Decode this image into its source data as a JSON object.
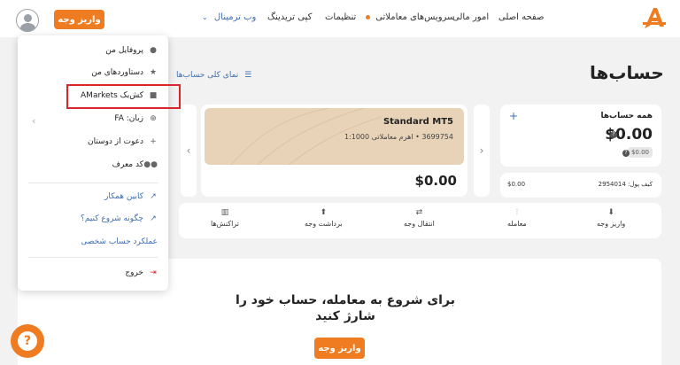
{
  "header": {
    "deposit_label": "واریز وجه",
    "nav": {
      "web_terminal": "وب ترمینال",
      "copy_trading": "کپی تریدینگ",
      "settings": "تنظیمات",
      "trading_services": "سرویس‌های معاملاتی",
      "finance": "امور مالی",
      "home": "صفحه اصلی"
    },
    "logo_letter": "A"
  },
  "dropdown": {
    "items": [
      {
        "label": "پروفایل من",
        "icon": "user-icon"
      },
      {
        "label": "دستاوردهای من",
        "icon": "star-icon"
      },
      {
        "label": "کش‌بک AMarkets",
        "icon": "gift-icon"
      },
      {
        "label": "زبان: FA",
        "icon": "globe-icon"
      },
      {
        "label": "دعوت از دوستان",
        "icon": "add-user-icon"
      },
      {
        "label": "کد معرف",
        "icon": "users-icon"
      }
    ],
    "links": [
      {
        "label": "کابین همکار",
        "icon": "external-link-icon"
      },
      {
        "label": "چگونه شروع کنیم؟",
        "icon": "external-link-icon"
      },
      {
        "label": "عملکرد حساب شخصی"
      }
    ],
    "logout": "خروج"
  },
  "page": {
    "title": "حساب‌ها",
    "overview_link": "نمای کلی حساب‌ها"
  },
  "all_accounts": {
    "title": "همه حساب‌ها",
    "total": "$0.00",
    "pill": "$0.00",
    "wallet_label": "کیف پول: 2954014",
    "wallet_value": "$0.00"
  },
  "account": {
    "name": "Standard MT5",
    "info": "3699754 • اهرم معاملاتی 1:1000",
    "balance": "$0.00"
  },
  "actions": [
    {
      "label": "واریز وجه",
      "icon": "download-icon"
    },
    {
      "label": "معامله",
      "icon": "candles-icon"
    },
    {
      "label": "انتقال وجه",
      "icon": "transfer-icon"
    },
    {
      "label": "برداشت وجه",
      "icon": "upload-icon"
    },
    {
      "label": "تراکنش‌ها",
      "icon": "trash-icon"
    }
  ],
  "cta": {
    "text": "برای شروع به معامله، حساب خود را شارژ کنید",
    "button": "واریز وجه"
  },
  "colors": {
    "accent": "#f07c22",
    "link": "#3f6fb5",
    "account_card": "#e8d3b8",
    "highlight": "#d9262a"
  }
}
